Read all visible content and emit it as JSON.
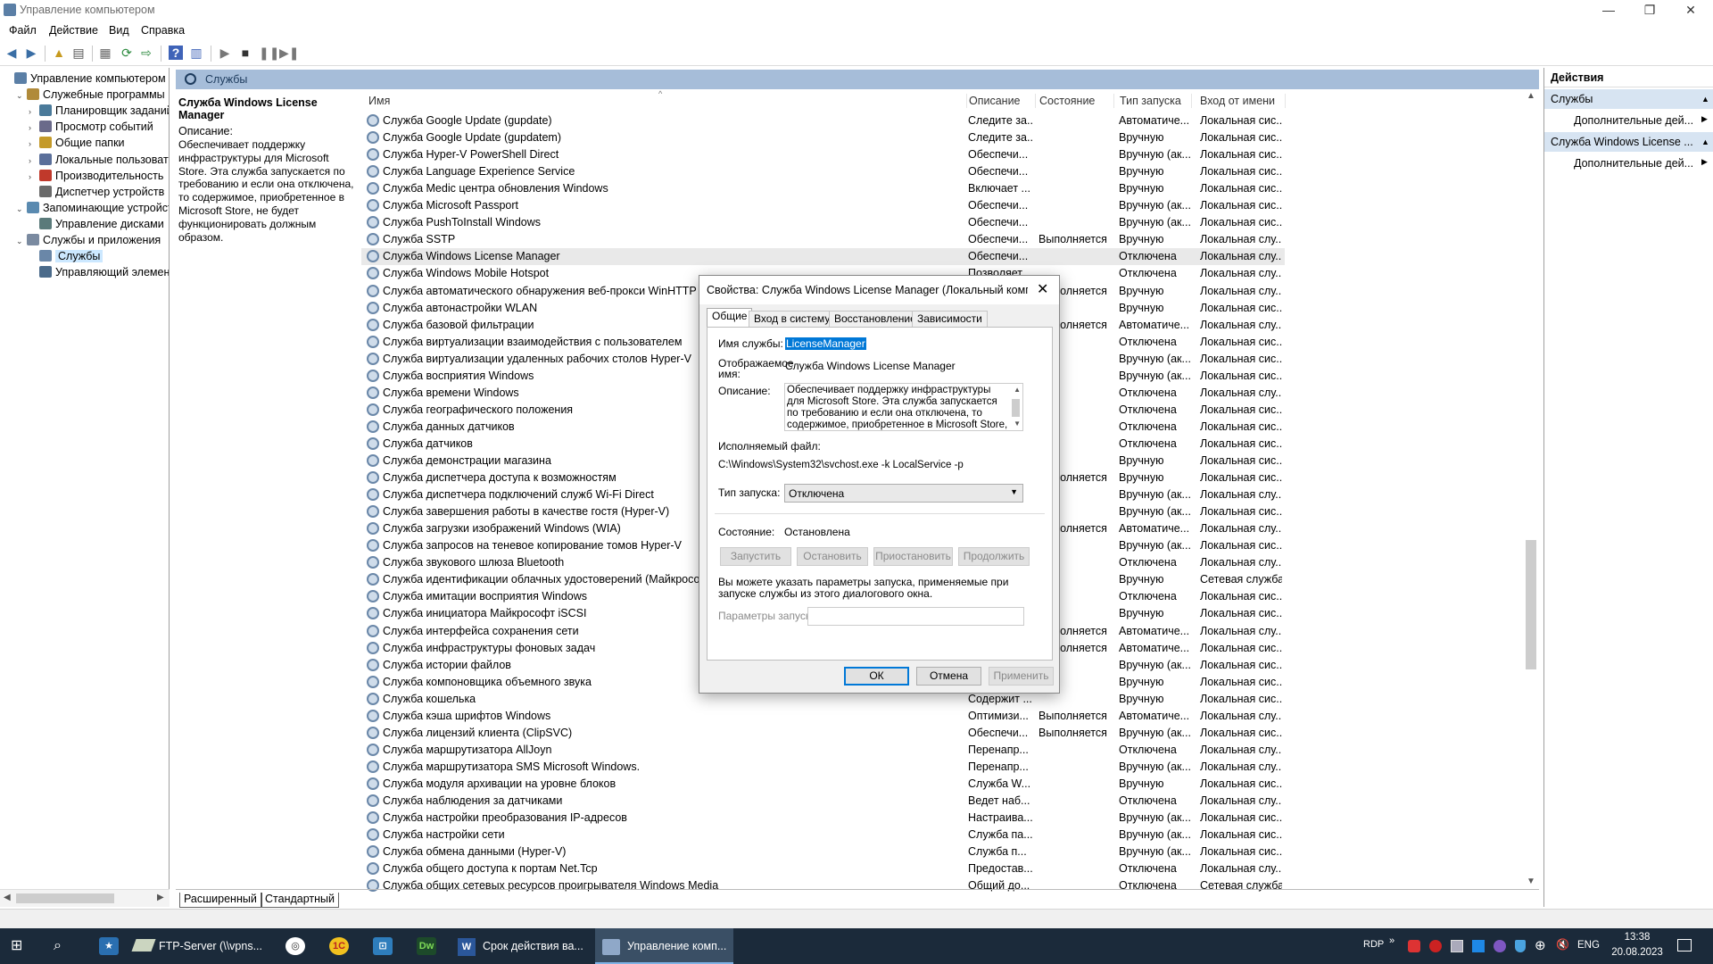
{
  "window": {
    "title": "Управление компьютером"
  },
  "menu": [
    "Файл",
    "Действие",
    "Вид",
    "Справка"
  ],
  "tree": [
    {
      "label": "Управление компьютером (л",
      "level": 0,
      "exp": ""
    },
    {
      "label": "Служебные программы",
      "level": 1,
      "exp": "v"
    },
    {
      "label": "Планировщик заданий",
      "level": 2,
      "exp": ">"
    },
    {
      "label": "Просмотр событий",
      "level": 2,
      "exp": ">"
    },
    {
      "label": "Общие папки",
      "level": 2,
      "exp": ">"
    },
    {
      "label": "Локальные пользовате",
      "level": 2,
      "exp": ">"
    },
    {
      "label": "Производительность",
      "level": 2,
      "exp": ">"
    },
    {
      "label": "Диспетчер устройств",
      "level": 2,
      "exp": ""
    },
    {
      "label": "Запоминающие устройст",
      "level": 1,
      "exp": "v"
    },
    {
      "label": "Управление дисками",
      "level": 2,
      "exp": ""
    },
    {
      "label": "Службы и приложения",
      "level": 1,
      "exp": "v"
    },
    {
      "label": "Службы",
      "level": 2,
      "exp": "",
      "selected": true
    },
    {
      "label": "Управляющий элемен",
      "level": 2,
      "exp": ""
    }
  ],
  "header": {
    "title": "Службы"
  },
  "extended": {
    "title": "Служба Windows License Manager",
    "desc_label": "Описание:",
    "desc": "Обеспечивает поддержку инфраструктуры для Microsoft Store. Эта служба запускается по требованию и если она отключена, то содержимое, приобретенное в Microsoft Store, не будет функционировать должным образом."
  },
  "columns": [
    "Имя",
    "Описание",
    "Состояние",
    "Тип запуска",
    "Вход от имени"
  ],
  "rows": [
    [
      "Служба Google Update (gupdate)",
      "Следите за...",
      "",
      "Автоматиче...",
      "Локальная сис..."
    ],
    [
      "Служба Google Update (gupdatem)",
      "Следите за...",
      "",
      "Вручную",
      "Локальная сис..."
    ],
    [
      "Служба Hyper-V PowerShell Direct",
      "Обеспечи...",
      "",
      "Вручную (ак...",
      "Локальная сис..."
    ],
    [
      "Служба Language Experience Service",
      "Обеспечи...",
      "",
      "Вручную",
      "Локальная сис..."
    ],
    [
      "Служба Medic центра обновления Windows",
      "Включает ...",
      "",
      "Вручную",
      "Локальная сис..."
    ],
    [
      "Служба Microsoft Passport",
      "Обеспечи...",
      "",
      "Вручную (ак...",
      "Локальная сис..."
    ],
    [
      "Служба PushToInstall Windows",
      "Обеспечи...",
      "",
      "Вручную (ак...",
      "Локальная сис..."
    ],
    [
      "Служба SSTP",
      "Обеспечи...",
      "Выполняется",
      "Вручную",
      "Локальная слу..."
    ],
    [
      "Служба Windows License Manager",
      "Обеспечи...",
      "",
      "Отключена",
      "Локальная слу..."
    ],
    [
      "Служба Windows Mobile Hotspot",
      "Позволяет...",
      "",
      "Отключена",
      "Локальная слу..."
    ],
    [
      "Служба автоматического обнаружения веб-прокси WinHTTP",
      "",
      "Выполняется",
      "Вручную",
      "Локальная слу..."
    ],
    [
      "Служба автонастройки WLAN",
      "",
      "",
      "Вручную",
      "Локальная сис..."
    ],
    [
      "Служба базовой фильтрации",
      "",
      "Выполняется",
      "Автоматиче...",
      "Локальная слу..."
    ],
    [
      "Служба виртуализации взаимодействия с пользователем",
      "",
      "",
      "Отключена",
      "Локальная сис..."
    ],
    [
      "Служба виртуализации удаленных рабочих столов Hyper-V",
      "",
      "",
      "Вручную (ак...",
      "Локальная сис..."
    ],
    [
      "Служба восприятия Windows",
      "",
      "",
      "Вручную (ак...",
      "Локальная сис..."
    ],
    [
      "Служба времени Windows",
      "",
      "",
      "Отключена",
      "Локальная слу..."
    ],
    [
      "Служба географического положения",
      "",
      "",
      "Отключена",
      "Локальная сис..."
    ],
    [
      "Служба данных датчиков",
      "",
      "",
      "Отключена",
      "Локальная сис..."
    ],
    [
      "Служба датчиков",
      "",
      "",
      "Отключена",
      "Локальная сис..."
    ],
    [
      "Служба демонстрации магазина",
      "",
      "",
      "Вручную",
      "Локальная сис..."
    ],
    [
      "Служба диспетчера доступа к возможностям",
      "",
      "Выполняется",
      "Вручную",
      "Локальная сис..."
    ],
    [
      "Служба диспетчера подключений служб Wi-Fi Direct",
      "",
      "",
      "Вручную (ак...",
      "Локальная слу..."
    ],
    [
      "Служба завершения работы в качестве гостя (Hyper-V)",
      "",
      "",
      "Вручную (ак...",
      "Локальная сис..."
    ],
    [
      "Служба загрузки изображений Windows (WIA)",
      "",
      "Выполняется",
      "Автоматиче...",
      "Локальная слу..."
    ],
    [
      "Служба запросов на теневое копирование томов Hyper-V",
      "",
      "",
      "Вручную (ак...",
      "Локальная сис..."
    ],
    [
      "Служба звукового шлюза Bluetooth",
      "",
      "",
      "Отключена",
      "Локальная слу..."
    ],
    [
      "Служба идентификации облачных удостоверений (Майкрософт)",
      "",
      "",
      "Вручную",
      "Сетевая служба"
    ],
    [
      "Служба имитации восприятия Windows",
      "",
      "",
      "Отключена",
      "Локальная сис..."
    ],
    [
      "Служба инициатора Майкрософт iSCSI",
      "",
      "",
      "Вручную",
      "Локальная сис..."
    ],
    [
      "Служба интерфейса сохранения сети",
      "",
      "Выполняется",
      "Автоматиче...",
      "Локальная слу..."
    ],
    [
      "Служба инфраструктуры фоновых задач",
      "",
      "Выполняется",
      "Автоматиче...",
      "Локальная сис..."
    ],
    [
      "Служба истории файлов",
      "",
      "",
      "Вручную (ак...",
      "Локальная сис..."
    ],
    [
      "Служба компоновщика объемного звука",
      "",
      "",
      "Вручную",
      "Локальная сис..."
    ],
    [
      "Служба кошелька",
      "Содержит ...",
      "",
      "Вручную",
      "Локальная сис..."
    ],
    [
      "Служба кэша шрифтов Windows",
      "Оптимизи...",
      "Выполняется",
      "Автоматиче...",
      "Локальная слу..."
    ],
    [
      "Служба лицензий клиента (ClipSVC)",
      "Обеспечи...",
      "Выполняется",
      "Вручную (ак...",
      "Локальная сис..."
    ],
    [
      "Служба маршрутизатора AllJoyn",
      "Перенапр...",
      "",
      "Отключена",
      "Локальная слу..."
    ],
    [
      "Служба маршрутизатора SMS Microsoft Windows.",
      "Перенапр...",
      "",
      "Вручную (ак...",
      "Локальная слу..."
    ],
    [
      "Служба модуля архивации на уровне блоков",
      "Служба W...",
      "",
      "Вручную",
      "Локальная сис..."
    ],
    [
      "Служба наблюдения за датчиками",
      "Ведет наб...",
      "",
      "Отключена",
      "Локальная слу..."
    ],
    [
      "Служба настройки преобразования IP-адресов",
      "Настраива...",
      "",
      "Вручную (ак...",
      "Локальная сис..."
    ],
    [
      "Служба настройки сети",
      "Служба па...",
      "",
      "Вручную (ак...",
      "Локальная сис..."
    ],
    [
      "Служба обмена данными (Hyper-V)",
      "Служба п...",
      "",
      "Вручную (ак...",
      "Локальная сис..."
    ],
    [
      "Служба общего доступа к портам Net.Tcp",
      "Предостав...",
      "",
      "Отключена",
      "Локальная слу..."
    ],
    [
      "Служба общих сетевых ресурсов проигрывателя Windows Media",
      "Общий до...",
      "",
      "Отключена",
      "Сетевая служба"
    ]
  ],
  "view_tabs": [
    "Расширенный",
    "Стандартный"
  ],
  "actions": {
    "header1": "Действия",
    "section1": "Службы",
    "item1": "Дополнительные дей...",
    "section2": "Служба Windows License ...",
    "item2": "Дополнительные дей..."
  },
  "dialog": {
    "title": "Свойства: Служба Windows License Manager (Локальный компь...",
    "tabs": [
      "Общие",
      "Вход в систему",
      "Восстановление",
      "Зависимости"
    ],
    "service_name_label": "Имя службы:",
    "service_name": "LicenseManager",
    "display_name_label1": "Отображаемое",
    "display_name_label2": "имя:",
    "display_name": "Служба Windows License Manager",
    "description_label": "Описание:",
    "description": "Обеспечивает поддержку инфраструктуры для Microsoft Store. Эта служба запускается по требованию и если она отключена, то содержимое, приобретенное в Microsoft Store,",
    "exe_label": "Исполняемый файл:",
    "exe_path": "C:\\Windows\\System32\\svchost.exe -k LocalService -p",
    "startup_label": "Тип запуска:",
    "startup_value": "Отключена",
    "state_label": "Состояние:",
    "state_value": "Остановлена",
    "btn_start": "Запустить",
    "btn_stop": "Остановить",
    "btn_pause": "Приостановить",
    "btn_resume": "Продолжить",
    "hint": "Вы можете указать параметры запуска, применяемые при запуске службы из этого диалогового окна.",
    "params_label": "Параметры запуска:",
    "ok": "ОК",
    "cancel": "Отмена",
    "apply": "Применить"
  },
  "taskbar": {
    "apps": [
      "FTP-Server (\\\\vpns...",
      "Срок действия ва...",
      "Управление комп..."
    ],
    "rdp": "RDP",
    "lang": "ENG",
    "time": "13:38",
    "date": "20.08.2023"
  }
}
